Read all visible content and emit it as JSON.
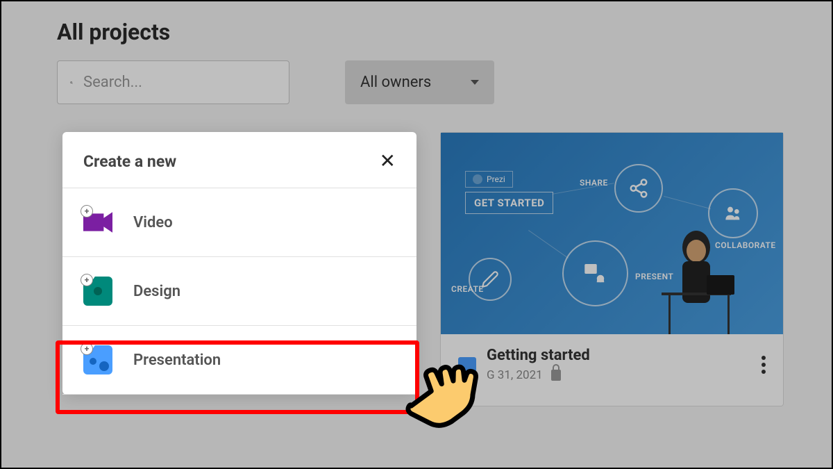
{
  "page": {
    "title": "All projects"
  },
  "search": {
    "placeholder": "Search..."
  },
  "filter": {
    "owners_label": "All owners"
  },
  "modal": {
    "title": "Create a new",
    "items": [
      {
        "label": "Video"
      },
      {
        "label": "Design"
      },
      {
        "label": "Presentation"
      }
    ]
  },
  "project": {
    "title": "Getting started",
    "date": "G 31, 2021",
    "thumbnail": {
      "brand": "Prezi",
      "get_started": "GET STARTED",
      "labels": {
        "share": "SHARE",
        "present": "PRESENT",
        "collaborate": "COLLABORATE",
        "create": "CREATE"
      }
    }
  }
}
